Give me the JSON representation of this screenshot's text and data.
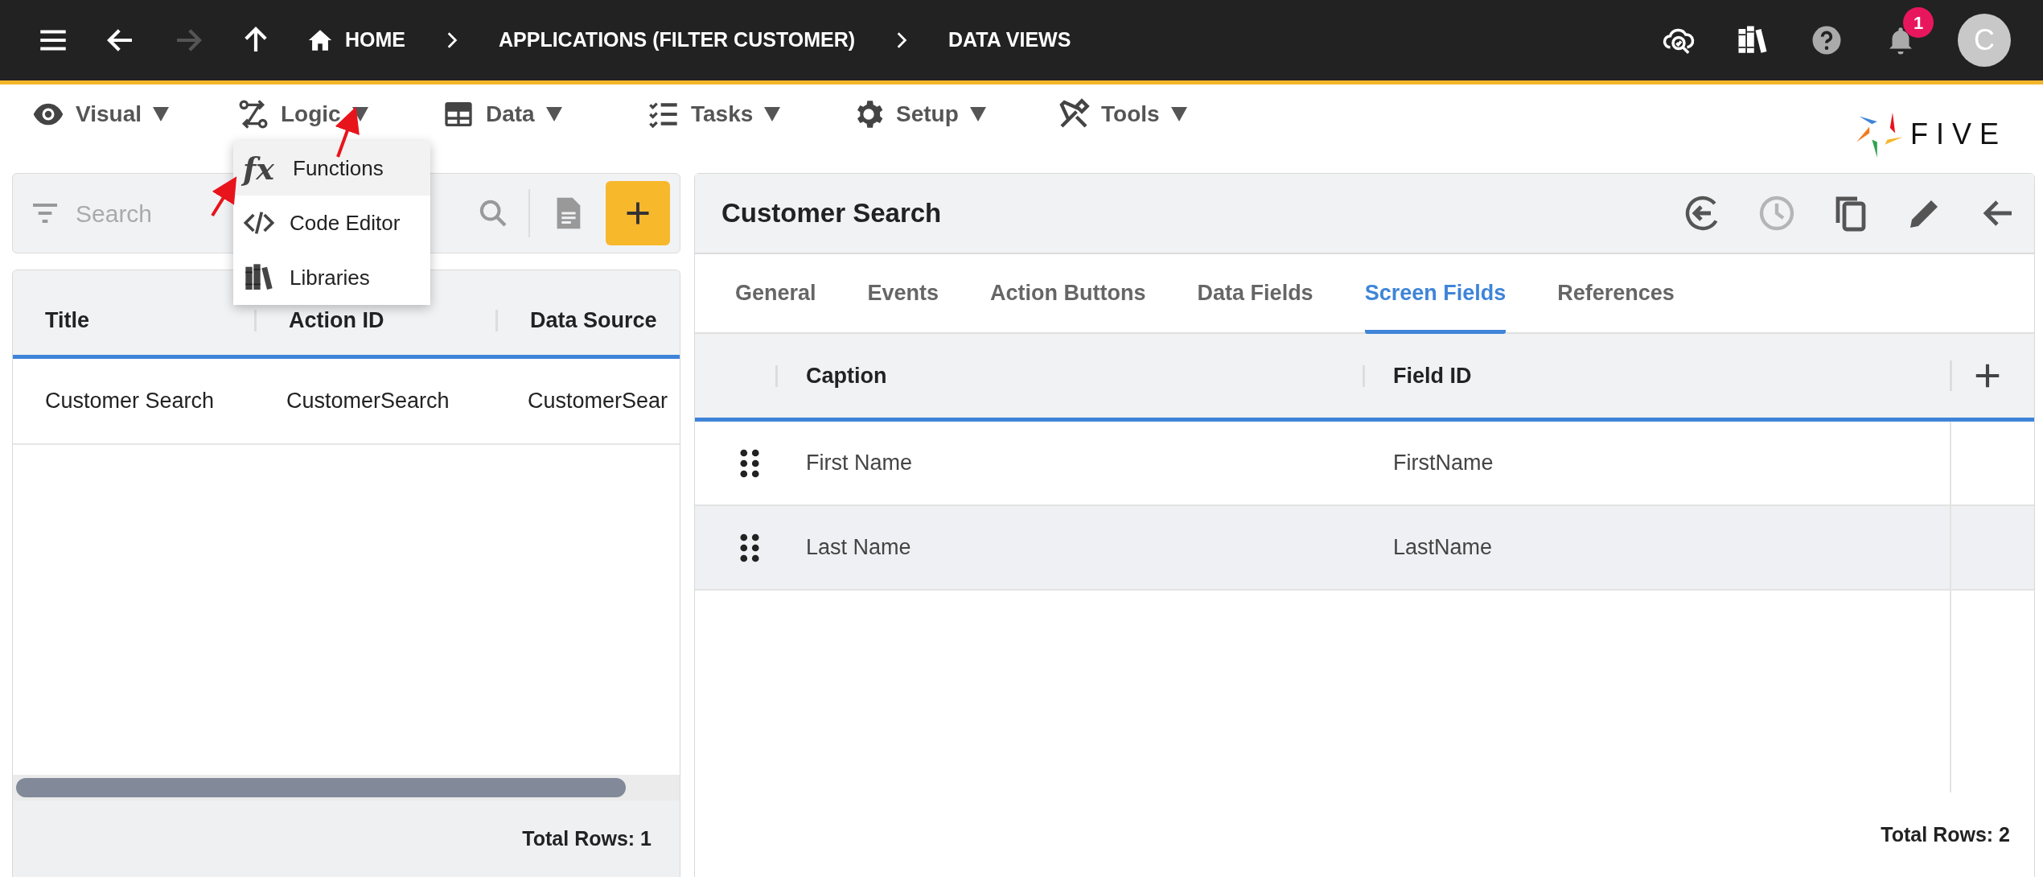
{
  "top_bar": {
    "nav": [
      {
        "kind": "menu",
        "disabled": false
      },
      {
        "kind": "back",
        "disabled": false
      },
      {
        "kind": "forward",
        "disabled": true
      },
      {
        "kind": "up",
        "disabled": false
      }
    ],
    "breadcrumbs": [
      {
        "label": "HOME",
        "kind": "home"
      },
      {
        "label": "APPLICATIONS (FILTER CUSTOMER)",
        "kind": "plain"
      },
      {
        "label": "DATA VIEWS",
        "kind": "plain"
      }
    ],
    "tools": [
      {
        "kind": "cloud"
      },
      {
        "kind": "books"
      },
      {
        "kind": "help"
      },
      {
        "kind": "bell",
        "badge": "1"
      }
    ],
    "avatar": "C"
  },
  "menu": [
    {
      "label": "Visual",
      "kind": "eye"
    },
    {
      "label": "Logic",
      "kind": "logic"
    },
    {
      "label": "Data",
      "kind": "table"
    },
    {
      "label": "Tasks",
      "kind": "tasks"
    },
    {
      "label": "Setup",
      "kind": "gear"
    },
    {
      "label": "Tools",
      "kind": "tools"
    }
  ],
  "dropdown": [
    {
      "label": "Functions",
      "kind": "fx",
      "glyph": "fx",
      "selected": true
    },
    {
      "label": "Code Editor",
      "kind": "code",
      "selected": false
    },
    {
      "label": "Libraries",
      "kind": "books",
      "selected": false
    }
  ],
  "logo": "FIVE",
  "left_panel": {
    "search": {
      "placeholder": "Search"
    },
    "columns": [
      "Title",
      "Action ID",
      "Data Source"
    ],
    "rows": [
      [
        "Customer Search",
        "CustomerSearch",
        "CustomerSear"
      ]
    ],
    "total": "Total Rows: 1"
  },
  "right_panel": {
    "title": "Customer Search",
    "actions": [
      {
        "kind": "exit",
        "disabled": false
      },
      {
        "kind": "history",
        "disabled": true
      },
      {
        "kind": "copy",
        "disabled": false
      },
      {
        "kind": "edit",
        "disabled": false
      },
      {
        "kind": "back",
        "disabled": false
      }
    ],
    "tabs": [
      {
        "label": "General",
        "selected": false
      },
      {
        "label": "Events",
        "selected": false
      },
      {
        "label": "Action Buttons",
        "selected": false
      },
      {
        "label": "Data Fields",
        "selected": false
      },
      {
        "label": "Screen Fields",
        "selected": true
      },
      {
        "label": "References",
        "selected": false
      }
    ],
    "columns": [
      "Caption",
      "Field ID"
    ],
    "rows": [
      {
        "cells": [
          "First Name",
          "FirstName"
        ],
        "highlighted": false
      },
      {
        "cells": [
          "Last Name",
          "LastName"
        ],
        "highlighted": true
      }
    ],
    "total": "Total Rows: 2"
  }
}
